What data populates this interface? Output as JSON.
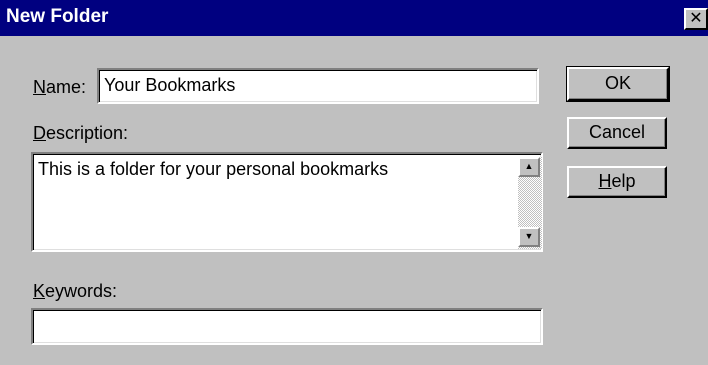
{
  "window": {
    "title": "New Folder",
    "close_glyph": "✕"
  },
  "form": {
    "name_label_accel": "N",
    "name_label_rest": "ame:",
    "name_value": "Your Bookmarks",
    "description_label_accel": "D",
    "description_label_rest": "escription:",
    "description_value": "This is a folder for your personal bookmarks",
    "keywords_label_accel": "K",
    "keywords_label_rest": "eywords:",
    "keywords_value": ""
  },
  "buttons": {
    "ok": "OK",
    "cancel": "Cancel",
    "help_accel": "H",
    "help_rest": "elp"
  },
  "scrollbar": {
    "up_glyph": "▲",
    "down_glyph": "▼"
  },
  "colors": {
    "titlebar": "#000080",
    "face": "#c0c0c0"
  }
}
